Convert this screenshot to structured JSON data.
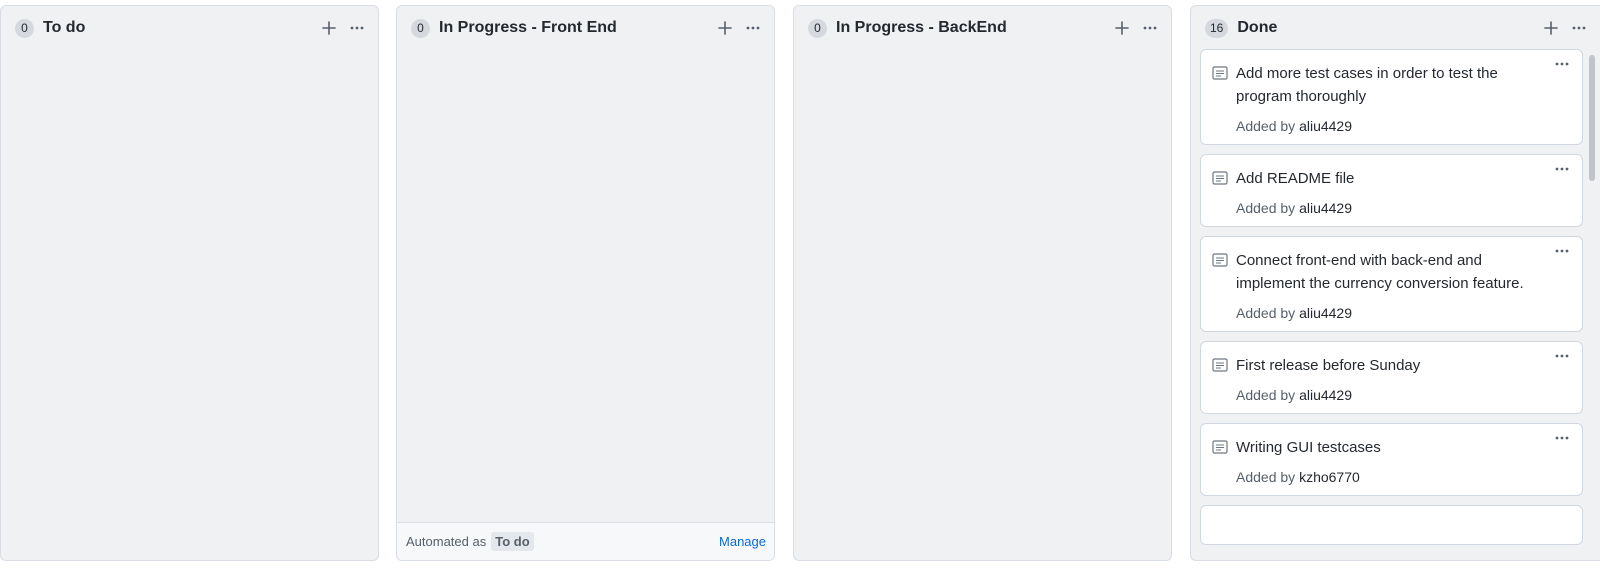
{
  "columns": [
    {
      "count": "0",
      "title": "To do"
    },
    {
      "count": "0",
      "title": "In Progress - Front End",
      "footer": {
        "prefix": "Automated as",
        "badge": "To do",
        "link": "Manage"
      }
    },
    {
      "count": "0",
      "title": "In Progress - BackEnd"
    },
    {
      "count": "16",
      "title": "Done",
      "cards": [
        {
          "title": "Add more test cases in order to test the program thoroughly",
          "added_by": "Added by",
          "author": "aliu4429"
        },
        {
          "title": "Add README file",
          "added_by": "Added by",
          "author": "aliu4429"
        },
        {
          "title": "Connect front-end with back-end and implement the currency conversion feature.",
          "added_by": "Added by",
          "author": "aliu4429"
        },
        {
          "title": "First release before Sunday",
          "added_by": "Added by",
          "author": "aliu4429"
        },
        {
          "title": "Writing GUI testcases",
          "added_by": "Added by",
          "author": "kzho6770"
        }
      ]
    }
  ],
  "icons": {
    "add": "plus-icon",
    "column_menu": "kebab-horizontal-icon",
    "note": "note-icon",
    "card_menu": "kebab-horizontal-icon"
  },
  "colors": {
    "column_bg": "#f0f1f3",
    "card_bg": "#ffffff",
    "link": "#0969da",
    "count_badge": "#d5d9de"
  }
}
